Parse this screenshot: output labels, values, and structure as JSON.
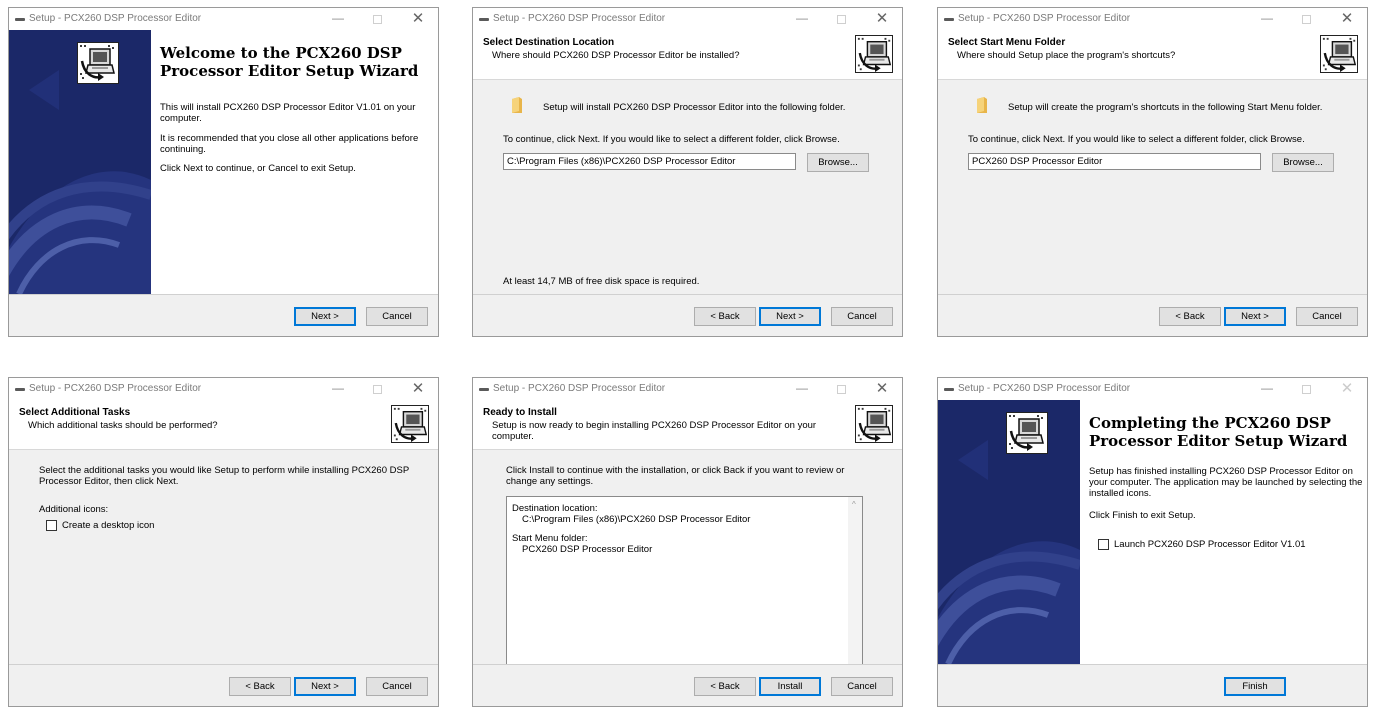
{
  "app_title": "Setup - PCX260 DSP Processor Editor",
  "buttons": {
    "back": "< Back",
    "next": "Next >",
    "cancel": "Cancel",
    "browse": "Browse...",
    "install": "Install",
    "finish": "Finish"
  },
  "icons": {
    "app": "setup-icon",
    "logo": "computer-install-icon",
    "folder": "folder-icon"
  },
  "welcome": {
    "heading": "Welcome to the PCX260 DSP Processor Editor Setup Wizard",
    "p1": "This will install PCX260 DSP Processor Editor V1.01 on your computer.",
    "p2": "It is recommended that you close all other applications before continuing.",
    "p3": "Click Next to continue, or Cancel to exit Setup."
  },
  "destination": {
    "title": "Select Destination Location",
    "subtitle": "Where should PCX260 DSP Processor Editor be installed?",
    "info": "Setup will install PCX260 DSP Processor Editor into the following folder.",
    "instruction": "To continue, click Next. If you would like to select a different folder, click Browse.",
    "path": "C:\\Program Files (x86)\\PCX260 DSP Processor Editor",
    "space": "At least 14,7 MB of free disk space is required."
  },
  "startmenu": {
    "title": "Select Start Menu Folder",
    "subtitle": "Where should Setup place the program's shortcuts?",
    "info": "Setup will create the program's shortcuts in the following Start Menu folder.",
    "instruction": "To continue, click Next. If you would like to select a different folder, click Browse.",
    "folder": "PCX260 DSP Processor Editor"
  },
  "tasks": {
    "title": "Select Additional Tasks",
    "subtitle": "Which additional tasks should be performed?",
    "instruction": "Select the additional tasks you would like Setup to perform while installing PCX260 DSP Processor Editor, then click Next.",
    "group": "Additional icons:",
    "desktop_icon": "Create a desktop icon"
  },
  "ready": {
    "title": "Ready to Install",
    "subtitle": "Setup is now ready to begin installing PCX260 DSP Processor Editor on your computer.",
    "instruction": "Click Install to continue with the installation, or click Back if you want to review or change any settings.",
    "dest_label": "Destination location:",
    "dest_value": "C:\\Program Files (x86)\\PCX260 DSP Processor Editor",
    "menu_label": "Start Menu folder:",
    "menu_value": "PCX260 DSP Processor Editor"
  },
  "finish": {
    "heading": "Completing the PCX260 DSP Processor Editor Setup Wizard",
    "p1": "Setup has finished installing PCX260 DSP Processor Editor on your computer. The application may be launched by selecting the installed icons.",
    "p2": "Click Finish to exit Setup.",
    "launch": "Launch PCX260 DSP Processor Editor V1.01"
  }
}
